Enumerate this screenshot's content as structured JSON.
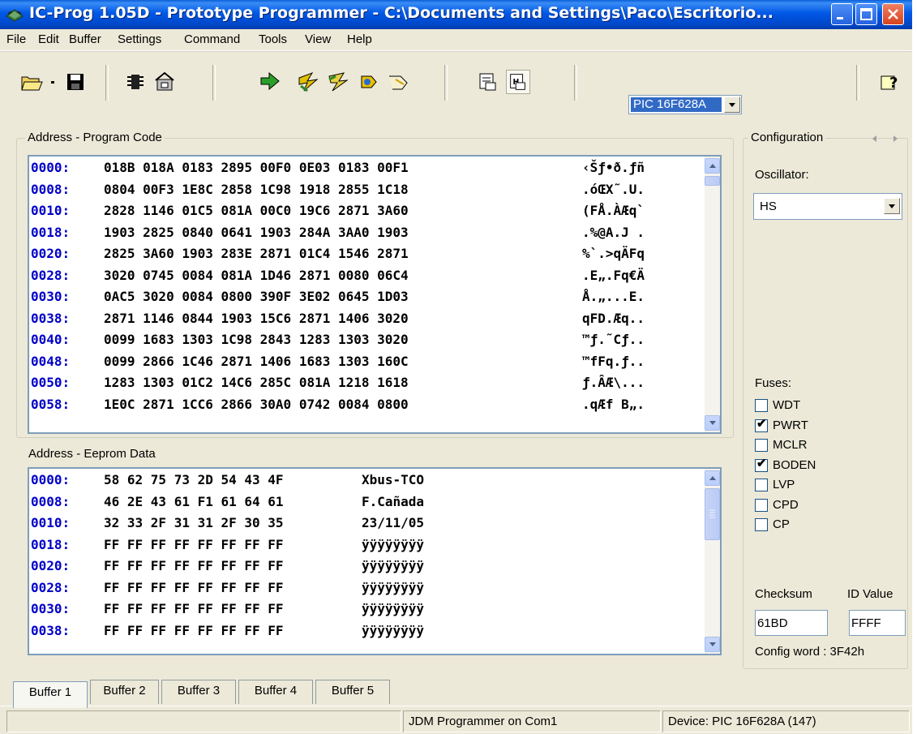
{
  "window": {
    "title": "IC-Prog 1.05D - Prototype Programmer - C:\\Documents and Settings\\Paco\\Escritorio..."
  },
  "menu": [
    "File",
    "Edit",
    "Buffer",
    "Settings",
    "Command",
    "Tools",
    "View",
    "Help"
  ],
  "toolbar": {
    "icons": [
      "open-icon",
      "dropdown-arrow-icon",
      "save-icon",
      "chip-icon",
      "settings-icon",
      "read-icon",
      "program-icon",
      "erase-icon",
      "verify-icon",
      "blank-check-icon",
      "view-asm-icon",
      "view-hex-icon",
      "help-icon"
    ],
    "device": "PIC 16F628A"
  },
  "program_code": {
    "label": "Address - Program Code",
    "rows": [
      {
        "addr": "0000:",
        "data": "018B 018A 0183 2895 00F0 0E03 0183 00F1",
        "ascii": "‹Šƒ•ð.ƒñ"
      },
      {
        "addr": "0008:",
        "data": "0804 00F3 1E8C 2858 1C98 1918 2855 1C18",
        "ascii": ".óŒX˜.U."
      },
      {
        "addr": "0010:",
        "data": "2828 1146 01C5 081A 00C0 19C6 2871 3A60",
        "ascii": "(FÅ.ÀÆq`"
      },
      {
        "addr": "0018:",
        "data": "1903 2825 0840 0641 1903 284A 3AA0 1903",
        "ascii": ".%@A.J ."
      },
      {
        "addr": "0020:",
        "data": "2825 3A60 1903 283E 2871 01C4 1546 2871",
        "ascii": "%`.>qÄFq"
      },
      {
        "addr": "0028:",
        "data": "3020 0745 0084 081A 1D46 2871 0080 06C4",
        "ascii": ".E„.Fq€Ä"
      },
      {
        "addr": "0030:",
        "data": "0AC5 3020 0084 0800 390F 3E02 0645 1D03",
        "ascii": "Å.„...E."
      },
      {
        "addr": "0038:",
        "data": "2871 1146 0844 1903 15C6 2871 1406 3020",
        "ascii": "qFD.Æq.."
      },
      {
        "addr": "0040:",
        "data": "0099 1683 1303 1C98 2843 1283 1303 3020",
        "ascii": "™ƒ.˜Cƒ.."
      },
      {
        "addr": "0048:",
        "data": "0099 2866 1C46 2871 1406 1683 1303 160C",
        "ascii": "™fFq.ƒ.."
      },
      {
        "addr": "0050:",
        "data": "1283 1303 01C2 14C6 285C 081A 1218 1618",
        "ascii": "ƒ.ÂÆ\\..."
      },
      {
        "addr": "0058:",
        "data": "1E0C 2871 1CC6 2866 30A0 0742 0084 0800",
        "ascii": ".qÆf B„."
      }
    ]
  },
  "eeprom": {
    "label": "Address - Eeprom Data",
    "rows": [
      {
        "addr": "0000:",
        "data": "58 62 75 73 2D 54 43 4F",
        "ascii": "Xbus-TCO"
      },
      {
        "addr": "0008:",
        "data": "46 2E 43 61 F1 61 64 61",
        "ascii": "F.Cañada"
      },
      {
        "addr": "0010:",
        "data": "32 33 2F 31 31 2F 30 35",
        "ascii": "23/11/05"
      },
      {
        "addr": "0018:",
        "data": "FF FF FF FF FF FF FF FF",
        "ascii": "ÿÿÿÿÿÿÿÿ"
      },
      {
        "addr": "0020:",
        "data": "FF FF FF FF FF FF FF FF",
        "ascii": "ÿÿÿÿÿÿÿÿ"
      },
      {
        "addr": "0028:",
        "data": "FF FF FF FF FF FF FF FF",
        "ascii": "ÿÿÿÿÿÿÿÿ"
      },
      {
        "addr": "0030:",
        "data": "FF FF FF FF FF FF FF FF",
        "ascii": "ÿÿÿÿÿÿÿÿ"
      },
      {
        "addr": "0038:",
        "data": "FF FF FF FF FF FF FF FF",
        "ascii": "ÿÿÿÿÿÿÿÿ"
      }
    ]
  },
  "config": {
    "label": "Configuration",
    "oscillator_label": "Oscillator:",
    "oscillator": "HS",
    "fuses_label": "Fuses:",
    "fuses": [
      {
        "name": "WDT",
        "checked": false
      },
      {
        "name": "PWRT",
        "checked": true
      },
      {
        "name": "MCLR",
        "checked": false
      },
      {
        "name": "BODEN",
        "checked": true
      },
      {
        "name": "LVP",
        "checked": false
      },
      {
        "name": "CPD",
        "checked": false
      },
      {
        "name": "CP",
        "checked": false
      }
    ],
    "checksum_label": "Checksum",
    "checksum": "61BD",
    "id_label": "ID Value",
    "id_value": "FFFF",
    "config_word": "Config word : 3F42h"
  },
  "tabs": [
    "Buffer 1",
    "Buffer 2",
    "Buffer 3",
    "Buffer 4",
    "Buffer 5"
  ],
  "active_tab": "Buffer 1",
  "status": {
    "left": "",
    "programmer": "JDM Programmer on Com1",
    "device": "Device: PIC 16F628A  (147)"
  },
  "colors": {
    "title_bar": "#0058e6",
    "address_text": "#0000c8",
    "selection": "#316ac5",
    "window_bg": "#ece9d8"
  }
}
